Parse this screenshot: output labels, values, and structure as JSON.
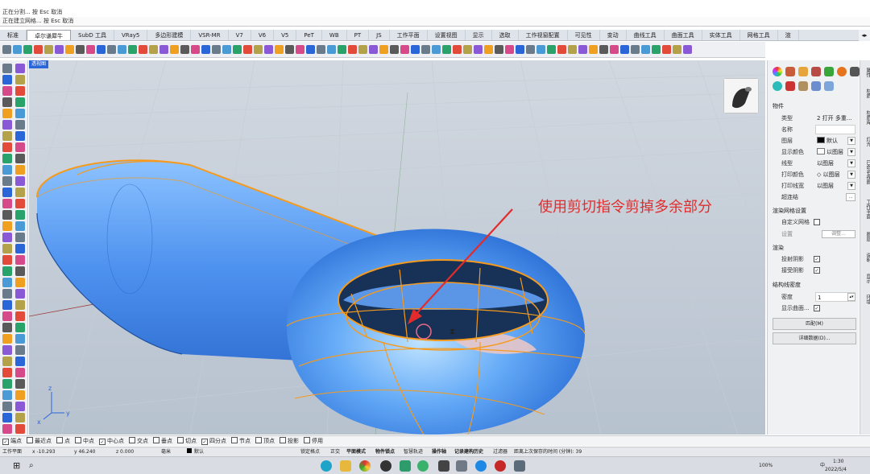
{
  "command_history": {
    "lines": [
      "正在分割... 按 Esc 取消",
      "正在建立网格... 按 Esc 取消"
    ]
  },
  "tabs": [
    "标准",
    "卓尔谦犀牛",
    "SubD 工具",
    "VRay5",
    "多边形建模",
    "VSR-MR",
    "V7",
    "V6",
    "V5",
    "PeT",
    "WB",
    "PT",
    "JS",
    "工作平面",
    "设置视图",
    "显示",
    "选取",
    "工作视窗配置",
    "可见性",
    "变动",
    "曲线工具",
    "曲面工具",
    "实体工具",
    "网格工具",
    "渲"
  ],
  "active_tab": "卓尔谦犀牛",
  "viewport": {
    "tab_label": "透视图",
    "annotation": "使用剪切指令剪掉多余部分",
    "colors": {
      "annotation": "#e22c2c",
      "surface": "#4f96f2",
      "edge": "#f59a1d"
    }
  },
  "properties": {
    "section_object": "物件",
    "type_label": "类型",
    "type_value": "2 打开 多重...",
    "name_label": "名称",
    "name_value": "",
    "layer_label": "图层",
    "layer_value": "默认",
    "display_color_label": "显示颜色",
    "display_color_value": "以图层",
    "linetype_label": "线型",
    "linetype_value": "以图层",
    "print_color_label": "打印颜色",
    "print_color_value": "以图层",
    "print_width_label": "打印线宽",
    "print_width_value": "以图层",
    "hyperlink_label": "超连结",
    "hyperlink_btn": "...",
    "section_render_mesh": "渲染网格设置",
    "custom_mesh_label": "自定义网格",
    "settings_label": "设置",
    "adjust_btn": "调整...",
    "section_render": "渲染",
    "cast_shadow_label": "投射阴影",
    "receive_shadow_label": "接受阴影",
    "section_isocurve": "结构线密度",
    "density_label": "密度",
    "density_value": "1",
    "show_surface_label": "显示曲面...",
    "match_btn": "匹配(M)",
    "details_btn": "详细数据(D)..."
  },
  "right_strip": [
    "属性",
    "材质",
    "材质库",
    "灯光",
    "已命名视图",
    "工作平面",
    "图层",
    "说明",
    "显示",
    "环境"
  ],
  "osnaps": [
    {
      "label": "端点",
      "checked": true
    },
    {
      "label": "最近点",
      "checked": false
    },
    {
      "label": "点",
      "checked": false
    },
    {
      "label": "中点",
      "checked": false
    },
    {
      "label": "中心点",
      "checked": true
    },
    {
      "label": "交点",
      "checked": false
    },
    {
      "label": "垂点",
      "checked": false
    },
    {
      "label": "切点",
      "checked": false
    },
    {
      "label": "四分点",
      "checked": true
    },
    {
      "label": "节点",
      "checked": false
    },
    {
      "label": "顶点",
      "checked": false
    },
    {
      "label": "投影",
      "checked": false
    },
    {
      "label": "停用",
      "checked": false
    }
  ],
  "status": {
    "cplane": "工作平面",
    "x": "x -10.293",
    "y": "y 46.240",
    "z": "z 0.000",
    "unit": "毫米",
    "layer": "默认",
    "grid_snap": "锁定格点",
    "ortho": "正交",
    "planar": "平面模式",
    "osnap": "物件锁点",
    "smarttrack": "智慧轨迹",
    "gumball": "操作轴",
    "history": "记录建构历史",
    "filter": "过滤器",
    "autosave": "距离上次保存的时间 (分钟): 39"
  },
  "taskbar": {
    "battery": "100%",
    "ime": "中",
    "time": "1:30",
    "date": "2022/5/4"
  }
}
